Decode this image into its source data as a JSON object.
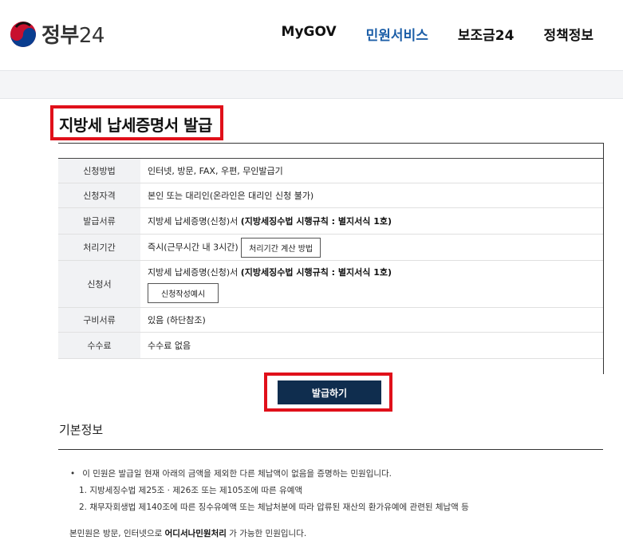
{
  "header": {
    "logo_text": "정부",
    "logo_num": "24",
    "nav": [
      "MyGOV",
      "민원서비스",
      "보조금24",
      "정책정보"
    ],
    "active_nav": "민원서비스"
  },
  "page": {
    "title": "지방세 납세증명서 발급"
  },
  "info": {
    "rows": [
      {
        "label": "신청방법",
        "value": "인터넷, 방문, FAX, 우편, 무인발급기"
      },
      {
        "label": "신청자격",
        "value": "본인 또는 대리인(온라인은 대리인 신청 불가)"
      },
      {
        "label": "발급서류",
        "value_plain": "지방세 납세증명(신청)서 ",
        "value_bold": "(지방세징수법 시행규칙 : 별지서식 1호)"
      },
      {
        "label": "처리기간",
        "value": "즉시(근무시간 내 3시간)",
        "button": "처리기간 계산 방법"
      },
      {
        "label": "신청서",
        "value_plain": "지방세 납세증명(신청)서 ",
        "value_bold": "(지방세징수법 시행규칙 : 별지서식 1호)",
        "button": "신청작성예시"
      },
      {
        "label": "구비서류",
        "value": "있음 (하단참조)"
      },
      {
        "label": "수수료",
        "value": "수수료 없음"
      }
    ]
  },
  "issue_button": "발급하기",
  "basic": {
    "title": "기본정보",
    "bullet": "이 민원은 발급일 현재 아래의 금액을 제외한 다른 체납액이 없음을 증명하는 민원입니다.",
    "sub1": "1. 지방세징수법 제25조 · 제26조 또는 제105조에 따른 유예액",
    "sub2": "2. 채무자회생법 제140조에 따른 징수유예액 또는 체납처분에 따라 압류된 재산의 환가유예에 관련된 체납액 등",
    "note_plain": "본민원은 방문, 인터넷으로 ",
    "note_bold": "어디서나민원처리",
    "note_end": " 가 가능한 민원입니다."
  },
  "colors": {
    "accent": "#1d5fa8",
    "highlight_border": "#e0101a",
    "button_bg": "#0f2d4e"
  }
}
